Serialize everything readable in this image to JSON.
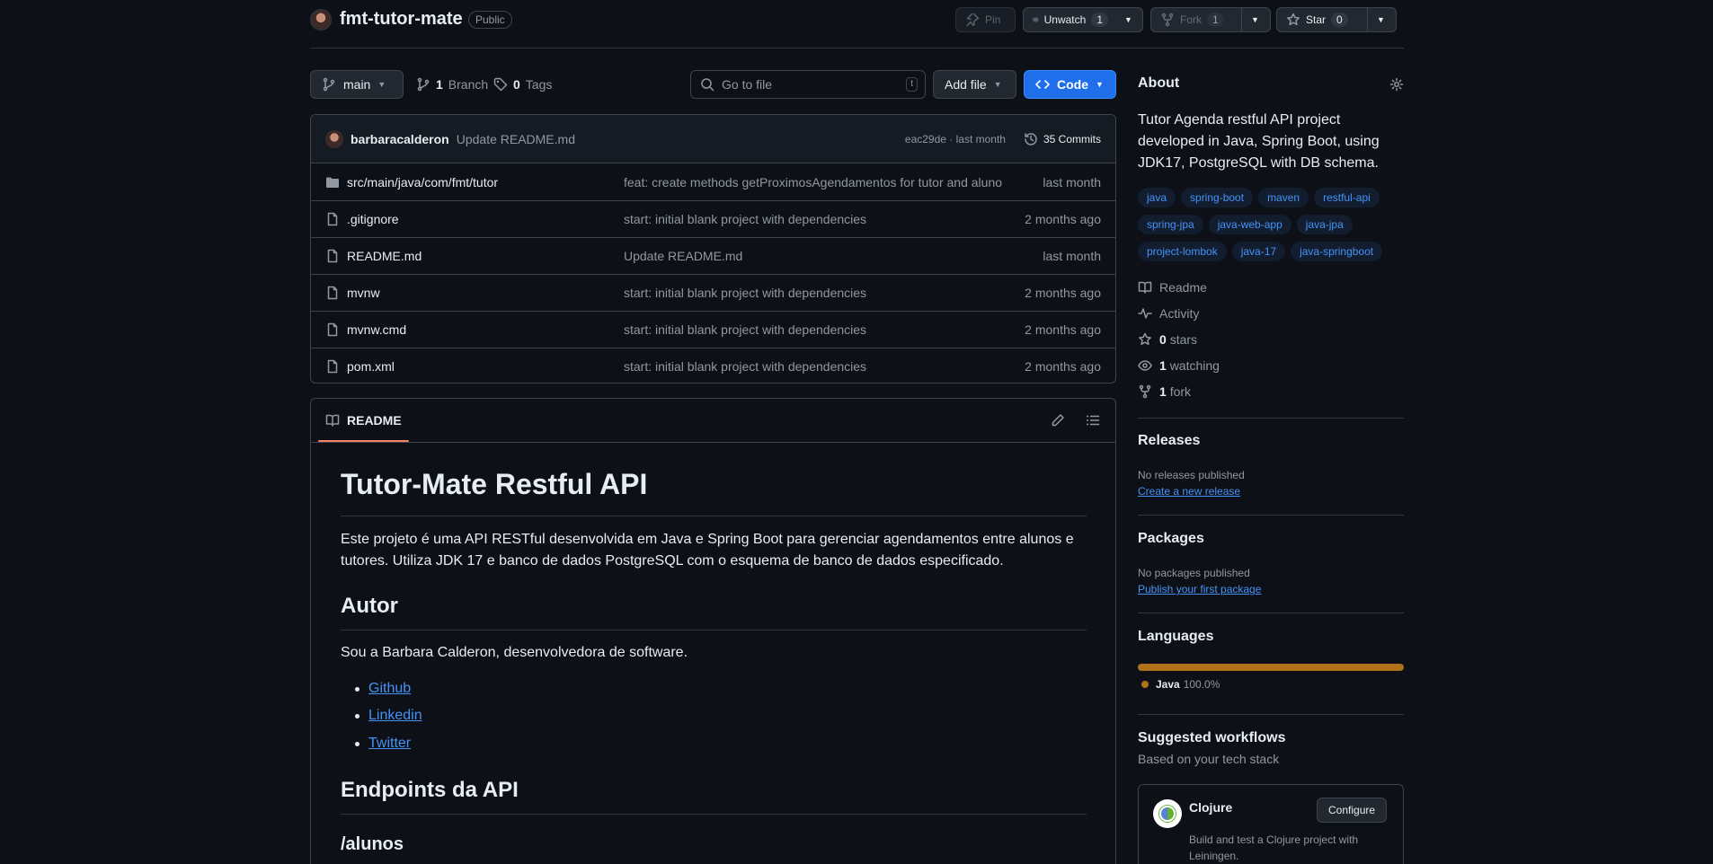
{
  "repo": {
    "name": "fmt-tutor-mate",
    "visibility": "Public"
  },
  "header": {
    "pin_label": "Pin",
    "unwatch_label": "Unwatch",
    "watch_count": "1",
    "fork_label": "Fork",
    "fork_count": "1",
    "star_label": "Star",
    "star_count": "0"
  },
  "toolbar": {
    "branch": "main",
    "branch_count": "1",
    "branch_label": "Branch",
    "tag_count": "0",
    "tag_label": "Tags",
    "search_placeholder": "Go to file",
    "search_key": "t",
    "add_file_label": "Add file",
    "code_label": "Code"
  },
  "latest_commit": {
    "author": "barbaracalderon",
    "message": "Update README.md",
    "hash_time": "eac29de · last month",
    "commits_label": "35 Commits"
  },
  "files": [
    {
      "name": "src/main/java/com/fmt/tutor",
      "type": "folder",
      "message": "feat: create methods getProximosAgendamentos for tutor and aluno",
      "date": "last month"
    },
    {
      "name": ".gitignore",
      "type": "file",
      "message": "start: initial blank project with dependencies",
      "date": "2 months ago"
    },
    {
      "name": "README.md",
      "type": "file",
      "message": "Update README.md",
      "date": "last month"
    },
    {
      "name": "mvnw",
      "type": "file",
      "message": "start: initial blank project with dependencies",
      "date": "2 months ago"
    },
    {
      "name": "mvnw.cmd",
      "type": "file",
      "message": "start: initial blank project with dependencies",
      "date": "2 months ago"
    },
    {
      "name": "pom.xml",
      "type": "file",
      "message": "start: initial blank project with dependencies",
      "date": "2 months ago"
    }
  ],
  "readme": {
    "tab_label": "README",
    "title": "Tutor-Mate Restful API",
    "intro": "Este projeto é uma API RESTful desenvolvida em Java e Spring Boot para gerenciar agendamentos entre alunos e tutores. Utiliza JDK 17 e banco de dados PostgreSQL com o esquema de banco de dados especificado.",
    "author_heading": "Autor",
    "author_text": "Sou a Barbara Calderon, desenvolvedora de software.",
    "links": [
      "Github",
      "Linkedin",
      "Twitter"
    ],
    "endpoints_heading": "Endpoints da API",
    "alunos_heading": "/alunos"
  },
  "about": {
    "heading": "About",
    "description": "Tutor Agenda restful API project developed in Java, Spring Boot, using JDK17, PostgreSQL with DB schema.",
    "topics": [
      "java",
      "spring-boot",
      "maven",
      "restful-api",
      "spring-jpa",
      "java-web-app",
      "java-jpa",
      "project-lombok",
      "java-17",
      "java-springboot"
    ],
    "readme_label": "Readme",
    "activity_label": "Activity",
    "stars_count": "0",
    "stars_label": "stars",
    "watching_count": "1",
    "watching_label": "watching",
    "fork_count": "1",
    "fork_label": "fork"
  },
  "releases": {
    "heading": "Releases",
    "empty": "No releases published",
    "link": "Create a new release"
  },
  "packages": {
    "heading": "Packages",
    "empty": "No packages published",
    "link": "Publish your first package"
  },
  "languages": {
    "heading": "Languages",
    "items": [
      {
        "name": "Java",
        "percent": "100.0%",
        "share": 1.0,
        "color": "#b07219"
      }
    ]
  },
  "workflows": {
    "heading": "Suggested workflows",
    "subheading": "Based on your tech stack",
    "card": {
      "name": "Clojure",
      "button": "Configure",
      "description": "Build and test a Clojure project with Leiningen."
    }
  }
}
